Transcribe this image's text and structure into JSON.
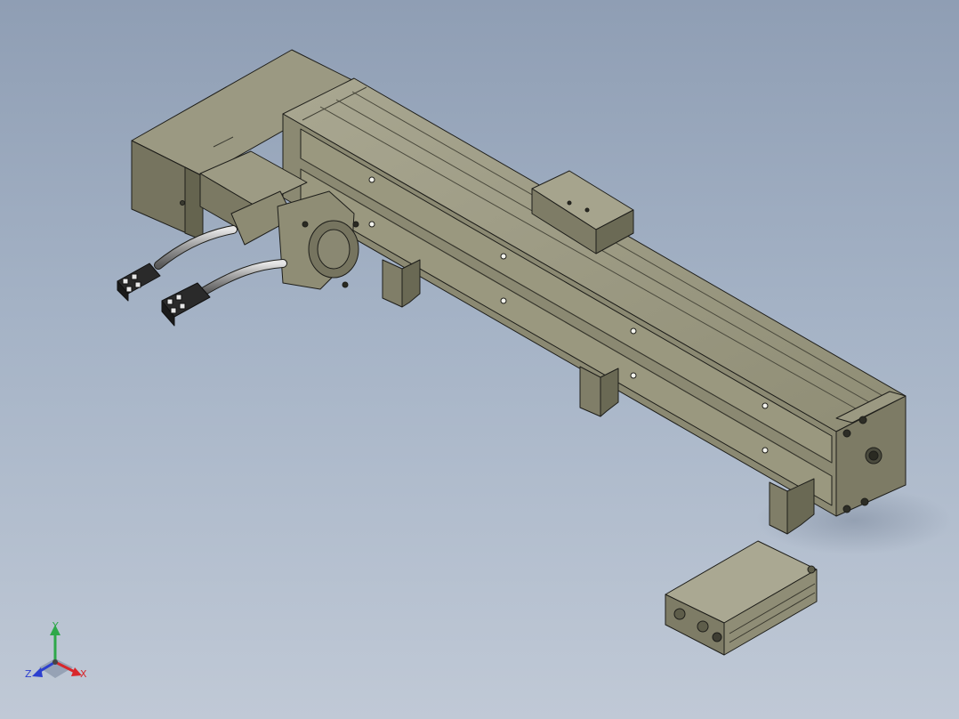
{
  "viewport": {
    "background_top": "#8f9eb4",
    "background_bottom": "#c0c9d6",
    "model_color": "#8d8b73",
    "edge_color": "#1e1e1a"
  },
  "triad": {
    "x_label": "X",
    "y_label": "Y",
    "z_label": "Z",
    "x_color": "#d8272b",
    "y_color": "#2ea84a",
    "z_color": "#2c3fcf"
  }
}
